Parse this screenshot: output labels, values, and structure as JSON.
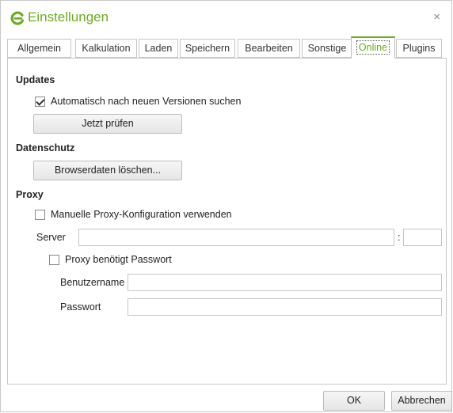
{
  "window": {
    "title": "Einstellungen",
    "close_glyph": "×",
    "logo_icon": "app-logo-icon",
    "accent_color": "#6bab1f"
  },
  "tabs": [
    {
      "label": "Allgemein"
    },
    {
      "label": "Kalkulation"
    },
    {
      "label": "Laden"
    },
    {
      "label": "Speichern"
    },
    {
      "label": "Bearbeiten"
    },
    {
      "label": "Sonstige"
    },
    {
      "label": "Online",
      "active": true
    },
    {
      "label": "Plugins"
    }
  ],
  "updates": {
    "heading": "Updates",
    "auto_check_label": "Automatisch nach neuen Versionen suchen",
    "auto_check_checked": true,
    "check_now_button": "Jetzt prüfen"
  },
  "privacy": {
    "heading": "Datenschutz",
    "clear_browser_data_button": "Browserdaten löschen..."
  },
  "proxy": {
    "heading": "Proxy",
    "manual_config_label": "Manuelle Proxy-Konfiguration verwenden",
    "manual_config_checked": false,
    "server_label": "Server",
    "server_value": "",
    "port_separator": ":",
    "port_value": "",
    "requires_password_label": "Proxy benötigt Passwort",
    "requires_password_checked": false,
    "username_label": "Benutzername",
    "username_value": "",
    "password_label": "Passwort",
    "password_value": ""
  },
  "footer": {
    "ok_button": "OK",
    "cancel_button": "Abbrechen"
  }
}
